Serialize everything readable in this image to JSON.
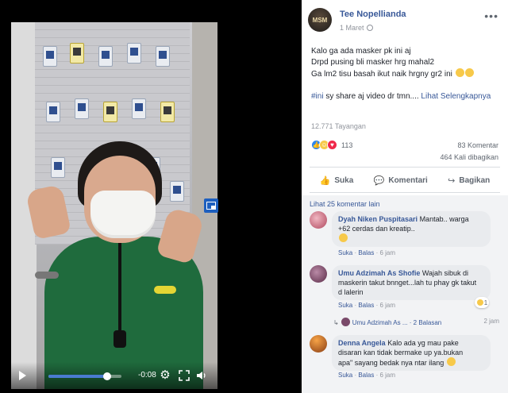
{
  "post": {
    "author": "Tee Nopellianda",
    "avatar_text": "MSM",
    "date": "1 Maret",
    "lines": [
      "Kalo ga ada masker pk ini aj",
      "Drpd pusing bli masker hrg mahal2",
      "Ga lm2 tisu basah ikut naik hrgny gr2 ini"
    ],
    "hashtag_line": "#ini sy share aj video dr tmn....",
    "see_more": "Lihat Selengkapnya",
    "views": "12.771 Tayangan",
    "reaction_count": "113",
    "comments_count": "83 Komentar",
    "shares_count": "464 Kali dibagikan"
  },
  "actions": {
    "like": "Suka",
    "comment": "Komentari",
    "share": "Bagikan"
  },
  "video": {
    "time_remaining": "-0:08",
    "progress": 0.8
  },
  "comments": {
    "view_more": "Lihat 25 komentar lain",
    "items": [
      {
        "name": "Dyah Niken Puspitasari",
        "text_1": "Mantab.. warga",
        "text_2": "+62 cerdas dan kreatip..",
        "like": "Suka",
        "reply": "Balas",
        "time": "6 jam"
      },
      {
        "name": "Umu Adzimah As Shofie",
        "text_1": "Wajah sibuk di",
        "text_2": "maskerin takut bnnget...lah tu phay gk takut",
        "text_3": "d lalerin",
        "like": "Suka",
        "reply": "Balas",
        "time": "6 jam",
        "reaction_count": "1"
      },
      {
        "name": "Denna Angela",
        "text_1": "Kalo ada yg mau pake",
        "text_2": "disaran kan tidak bermake up ya.bukan",
        "text_3": "apa\" sayang bedak nya ntar ilang",
        "like": "Suka",
        "reply": "Balas",
        "time": "6 jam"
      }
    ],
    "reply_row": {
      "name": "Umu Adzimah As ...",
      "separator": "·",
      "replies": "2 Balasan",
      "time": "2 jam"
    }
  },
  "colors": {
    "link": "#385898",
    "muted": "#90949c",
    "comment_bg": "#f2f3f5"
  }
}
